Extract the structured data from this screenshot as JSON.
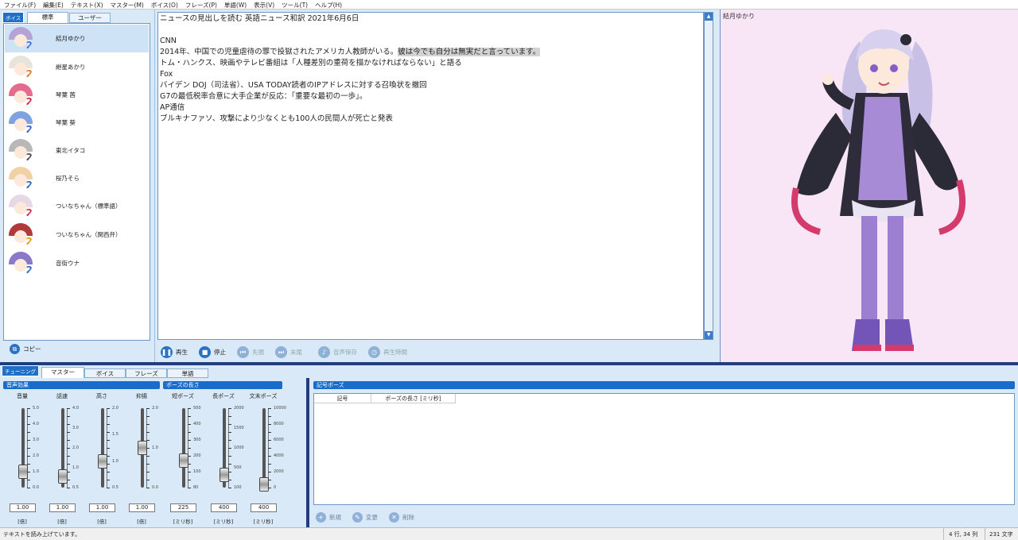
{
  "menu": [
    "ファイル(F)",
    "編集(E)",
    "テキスト(X)",
    "マスター(M)",
    "ボイス(O)",
    "フレーズ(P)",
    "単語(W)",
    "表示(V)",
    "ツール(T)",
    "ヘルプ(H)"
  ],
  "voice_panel": {
    "tag": "ボイス",
    "tabs": [
      "標準",
      "ユーザー"
    ],
    "voices": [
      "結月ゆかり",
      "紲星あかり",
      "琴葉 茜",
      "琴葉 葵",
      "東北イタコ",
      "桜乃そら",
      "ついなちゃん（標準語）",
      "ついなちゃん（関西弁）",
      "音街ウナ"
    ],
    "selected_index": 0,
    "copy_label": "コピー"
  },
  "text": {
    "lines": [
      "ニュースの見出しを読む 英語ニュース和訳 2021年6月6日",
      "",
      "CNN",
      "2014年、中国での児童虐待の罪で投獄されたアメリカ人教師がいる。",
      "トム・ハンクス、映画やテレビ番組は「人種差別の重荷を描かなければならない」と語る",
      "Fox",
      "バイデン DOJ（司法省）、USA TODAY読者のIPアドレスに対する召喚状を撤回",
      "G7の最低税率合意に大手企業が反応：「重要な最初の一歩」。",
      "AP通信",
      "ブルキナファソ、攻撃により少なくとも100人の民間人が死亡と発表"
    ],
    "highlight": "彼は今でも自分は無実だと言っています。"
  },
  "playbar": {
    "play": "再生",
    "stop": "停止",
    "head": "先頭",
    "end": "末尾",
    "save": "音声保存",
    "time": "再生時間"
  },
  "character": {
    "name": "結月ゆかり"
  },
  "tuning": {
    "tag": "チューニング",
    "tabs": [
      "マスター",
      "ボイス",
      "フレーズ",
      "単語"
    ],
    "sound_effect": "音声効果",
    "pause_length": "ポーズの長さ",
    "symbol_pause": "記号ポーズ",
    "sliders": [
      {
        "label": "音量",
        "value": "1.00",
        "unit": "[倍]",
        "ticks": [
          "5.0",
          "4.0",
          "3.0",
          "2.0",
          "1.0",
          "0.0"
        ],
        "level": 0.2
      },
      {
        "label": "話速",
        "value": "1.00",
        "unit": "[倍]",
        "ticks": [
          "4.0",
          "3.0",
          "2.0",
          "1.0",
          "0.5"
        ],
        "level": 0.14
      },
      {
        "label": "高さ",
        "value": "1.00",
        "unit": "[倍]",
        "ticks": [
          "2.0",
          "1.5",
          "1.0",
          "0.5"
        ],
        "level": 0.33
      },
      {
        "label": "抑揚",
        "value": "1.00",
        "unit": "[倍]",
        "ticks": [
          "2.0",
          "1.0",
          "0.0"
        ],
        "level": 0.5
      },
      {
        "label": "短ポーズ",
        "value": "225",
        "unit": "[ミリ秒]",
        "ticks": [
          "500",
          "400",
          "300",
          "200",
          "100",
          "80"
        ],
        "level": 0.34
      },
      {
        "label": "長ポーズ",
        "value": "400",
        "unit": "[ミリ秒]",
        "ticks": [
          "2000",
          "1500",
          "1000",
          "500",
          "100"
        ],
        "level": 0.16
      },
      {
        "label": "文末ポーズ",
        "value": "400",
        "unit": "[ミリ秒]",
        "ticks": [
          "10000",
          "8000",
          "6000",
          "4000",
          "2000",
          "0"
        ],
        "level": 0.04
      }
    ],
    "table_headers": [
      "記号",
      "ポーズの長さ [ミリ秒]"
    ],
    "actions": [
      "新規",
      "変更",
      "削除"
    ]
  },
  "status": {
    "message": "テキストを読み上げています。",
    "position": "4 行, 34 列",
    "chars": "231 文字"
  },
  "colors": {
    "accent": "#1a6ccc",
    "panel": "#d9e9f7",
    "character_bg": "#f8e6f7"
  }
}
